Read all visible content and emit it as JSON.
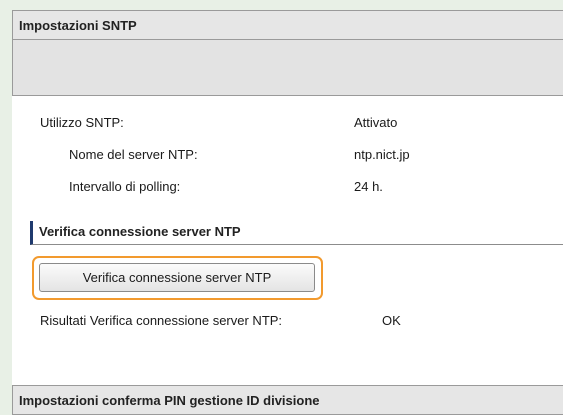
{
  "header": {
    "title": "Impostazioni SNTP"
  },
  "settings": {
    "sntp_label": "Utilizzo SNTP:",
    "sntp_value": "Attivato",
    "server_label": "Nome del server NTP:",
    "server_value": "ntp.nict.jp",
    "polling_label": "Intervallo di polling:",
    "polling_value": "24 h."
  },
  "verify": {
    "section_title": "Verifica connessione server NTP",
    "button_label": "Verifica connessione server NTP",
    "result_label": "Risultati Verifica connessione server NTP:",
    "result_value": "OK"
  },
  "footer": {
    "title": "Impostazioni conferma PIN gestione ID divisione"
  },
  "colors": {
    "highlight": "#f29a2e",
    "section_accent": "#1f3a6e"
  }
}
